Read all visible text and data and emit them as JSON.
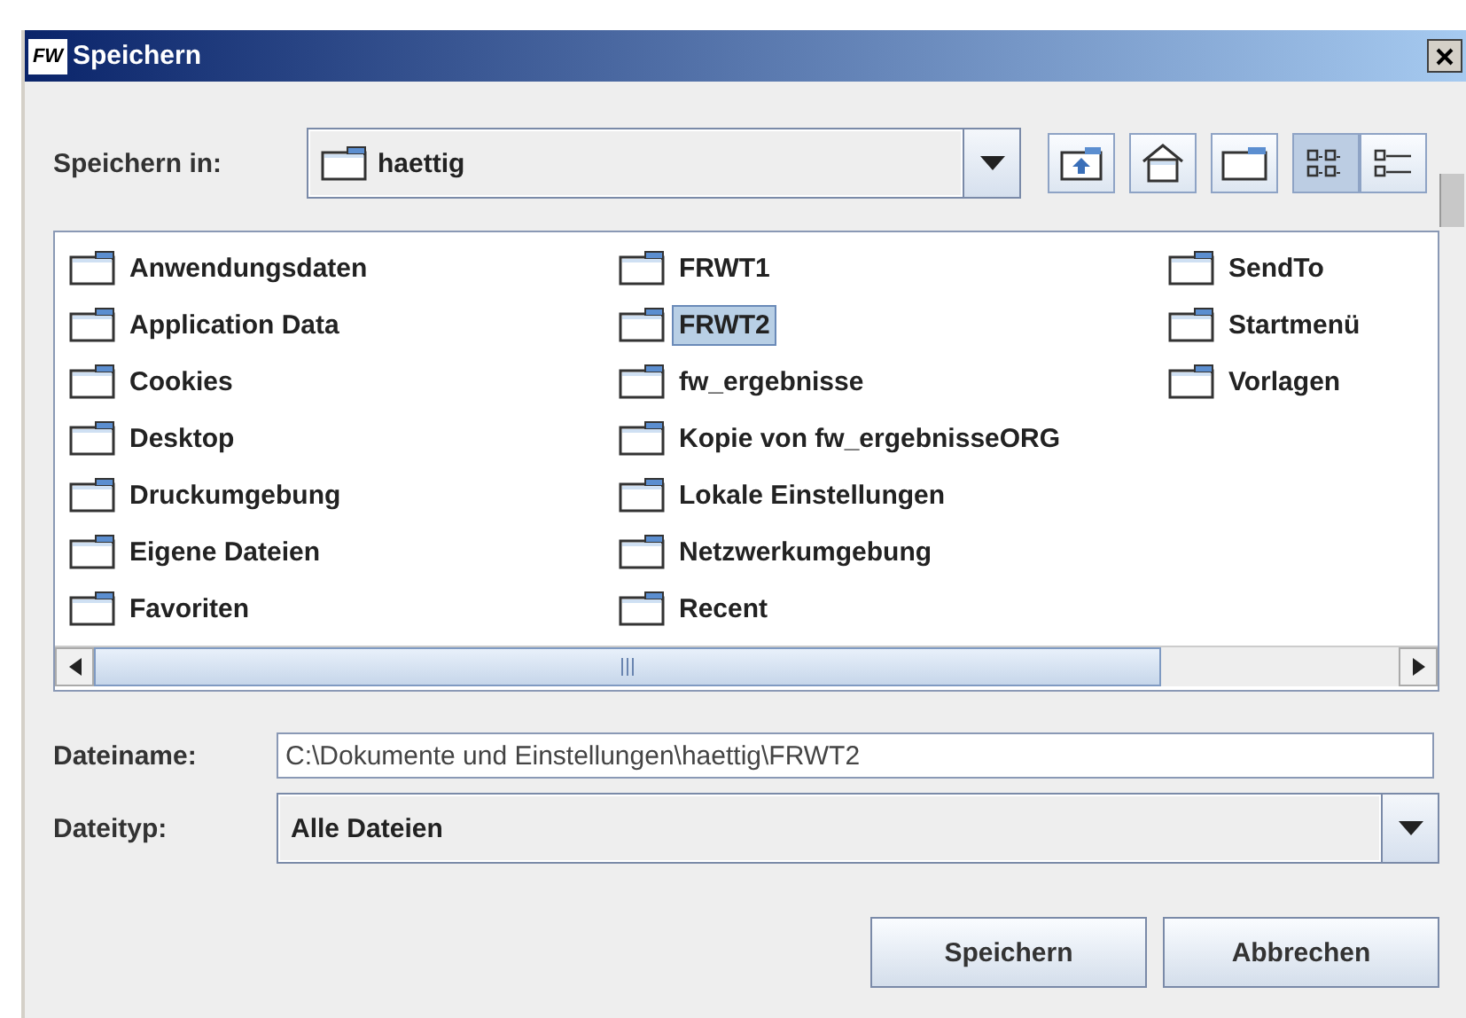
{
  "window": {
    "title": "Speichern",
    "logo": "FW"
  },
  "look_in": {
    "label": "Speichern in:",
    "value": "haettig"
  },
  "toolbar": [
    {
      "kind": "up",
      "selected": false
    },
    {
      "kind": "home",
      "selected": false
    },
    {
      "kind": "newfolder",
      "selected": false
    },
    {
      "kind": "list",
      "selected": true
    },
    {
      "kind": "details",
      "selected": false
    }
  ],
  "files": [
    {
      "name": "Anwendungsdaten",
      "selected": false
    },
    {
      "name": "Application Data",
      "selected": false
    },
    {
      "name": "Cookies",
      "selected": false
    },
    {
      "name": "Desktop",
      "selected": false
    },
    {
      "name": "Druckumgebung",
      "selected": false
    },
    {
      "name": "Eigene Dateien",
      "selected": false
    },
    {
      "name": "Favoriten",
      "selected": false
    },
    {
      "name": "FRWT1",
      "selected": false
    },
    {
      "name": "FRWT2",
      "selected": true
    },
    {
      "name": "fw_ergebnisse",
      "selected": false
    },
    {
      "name": "Kopie von fw_ergebnisseORG",
      "selected": false
    },
    {
      "name": "Lokale Einstellungen",
      "selected": false
    },
    {
      "name": "Netzwerkumgebung",
      "selected": false
    },
    {
      "name": "Recent",
      "selected": false
    },
    {
      "name": "SendTo",
      "selected": false
    },
    {
      "name": "Startmenü",
      "selected": false
    },
    {
      "name": "Vorlagen",
      "selected": false
    }
  ],
  "file_name": {
    "label": "Dateiname:",
    "value": "C:\\Dokumente und Einstellungen\\haettig\\FRWT2"
  },
  "file_type": {
    "label": "Dateityp:",
    "value": "Alle Dateien"
  },
  "buttons": [
    "Speichern",
    "Abbrechen"
  ]
}
